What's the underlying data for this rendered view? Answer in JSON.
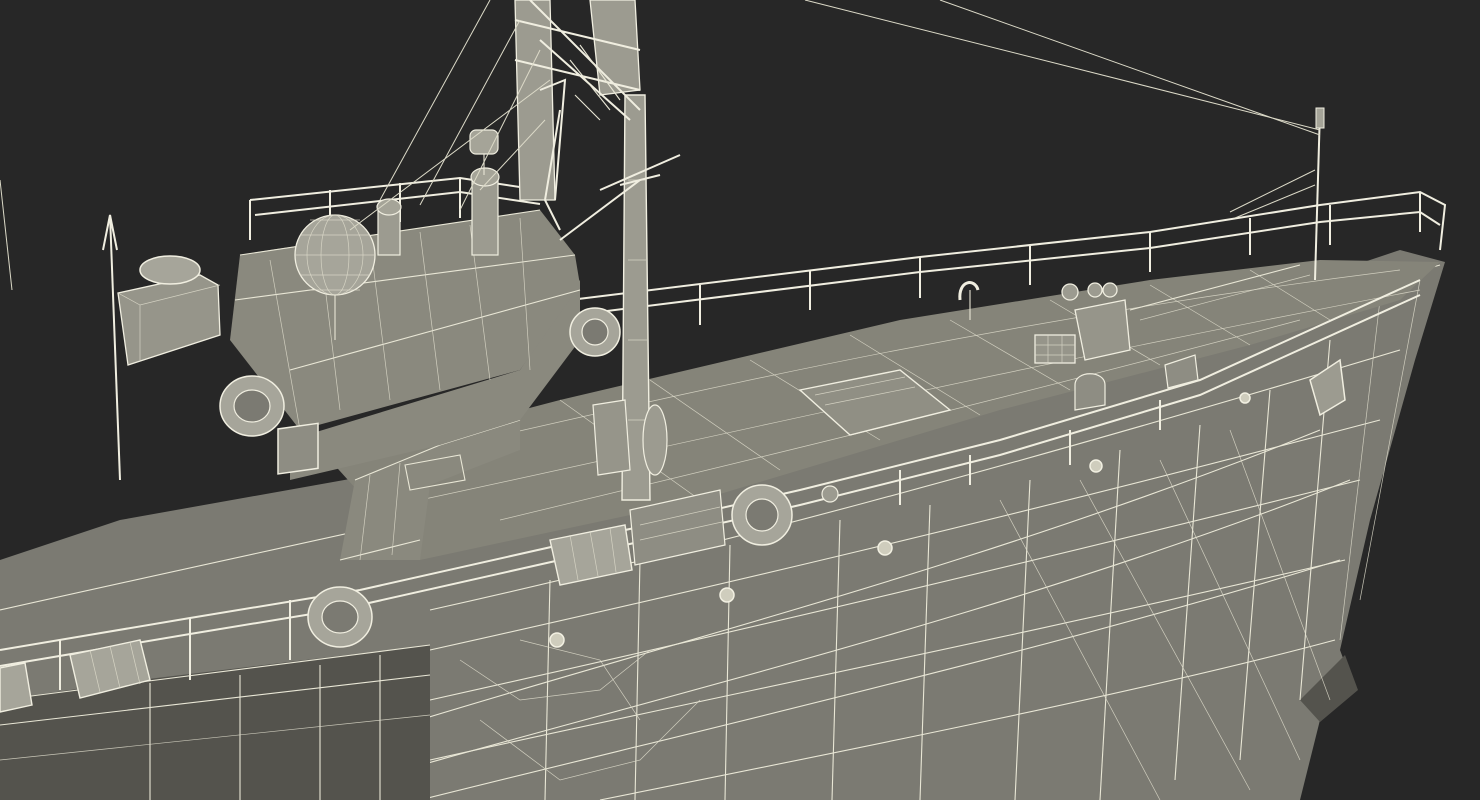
{
  "scene": {
    "background_color": "#272727",
    "mesh_color": "#e9e7d6",
    "hull_color": "#7b7a72",
    "deck_color": "#858479"
  }
}
